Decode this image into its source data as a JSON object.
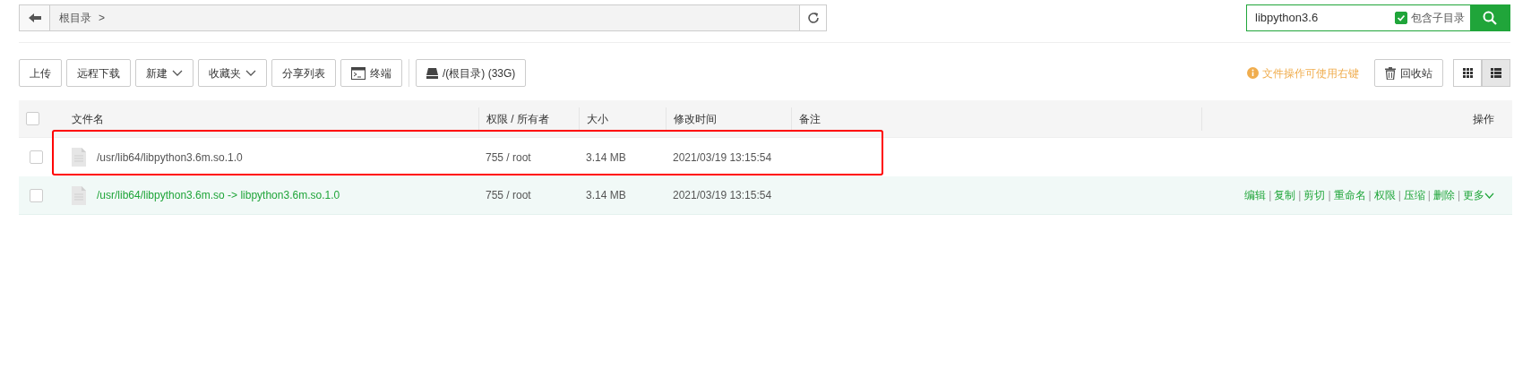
{
  "path_bar": {
    "crumbs": [
      "根目录"
    ],
    "separator": ">"
  },
  "search": {
    "value": "libpython3.6",
    "include_subdirs": {
      "label": "包含子目录",
      "checked": true
    }
  },
  "toolbar": {
    "buttons": [
      {
        "label": "上传",
        "kind": "plain"
      },
      {
        "label": "远程下载",
        "kind": "plain"
      },
      {
        "label": "新建",
        "kind": "dropdown"
      },
      {
        "label": "收藏夹",
        "kind": "dropdown"
      },
      {
        "label": "分享列表",
        "kind": "plain"
      },
      {
        "label": "终端",
        "kind": "terminal"
      },
      {
        "label": "/(根目录) (33G)",
        "kind": "disk"
      }
    ],
    "hint": "文件操作可使用右键",
    "recycle": "回收站",
    "views": [
      {
        "kind": "grid",
        "selected": false
      },
      {
        "kind": "list",
        "selected": true
      }
    ]
  },
  "table": {
    "select_all": {
      "checked": false
    },
    "action_separator": "|",
    "columns": [
      "文件名",
      "权限 / 所有者",
      "大小",
      "修改时间",
      "备注",
      "操作"
    ],
    "rows": [
      {
        "name": "/usr/lib64/libpython3.6m.so.1.0",
        "perm": "755 / root",
        "size": "3.14 MB",
        "mtime": "2021/03/19 13:15:54",
        "checked": false,
        "hovered": false,
        "highlighted": true,
        "actions": []
      },
      {
        "name": "/usr/lib64/libpython3.6m.so -> libpython3.6m.so.1.0",
        "perm": "755 / root",
        "size": "3.14 MB",
        "mtime": "2021/03/19 13:15:54",
        "checked": false,
        "hovered": true,
        "highlighted": false,
        "actions": [
          "编辑",
          "复制",
          "剪切",
          "重命名",
          "权限",
          "压缩",
          "删除",
          "更多"
        ]
      }
    ]
  }
}
